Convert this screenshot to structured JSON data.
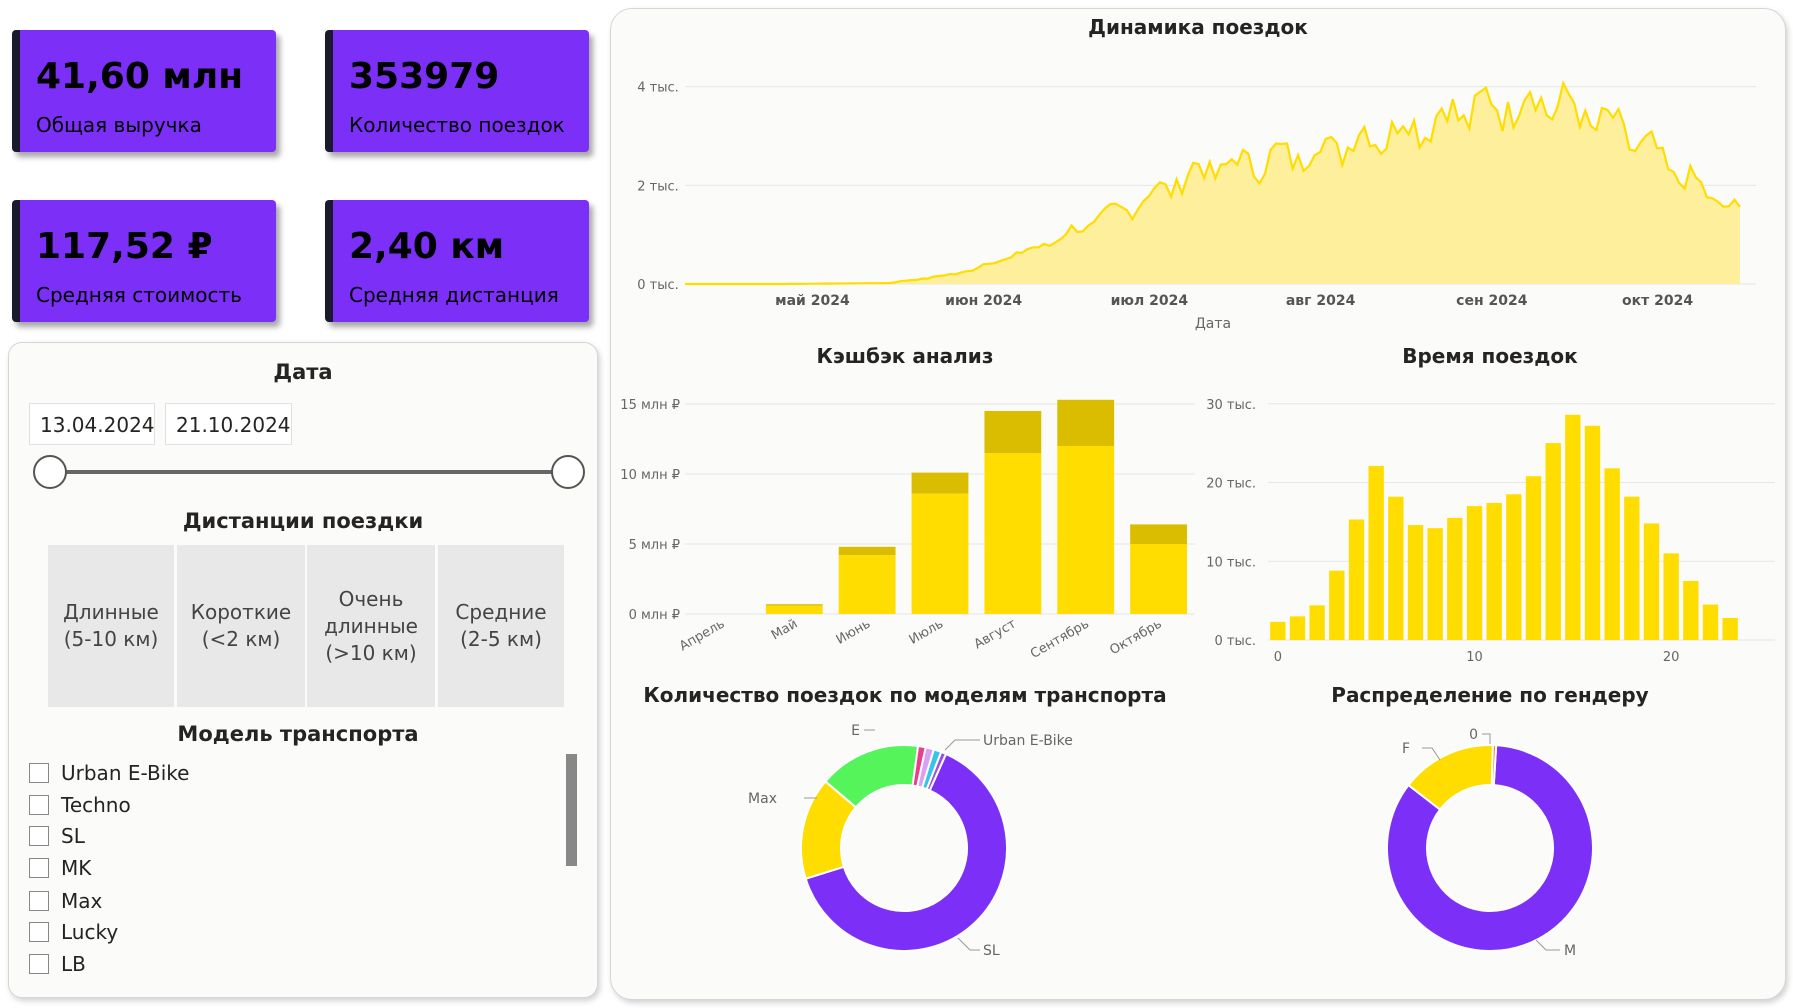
{
  "kpis": [
    {
      "value": "41,60 млн",
      "label": "Общая выручка"
    },
    {
      "value": "353979",
      "label": "Количество поездок"
    },
    {
      "value": "117,52 ₽",
      "label": "Средняя стоимость"
    },
    {
      "value": "2,40 км",
      "label": "Средняя дистанция"
    }
  ],
  "colors": {
    "accent": "#7b2ff7",
    "yellow": "#ffdd00",
    "yellow_dark": "#dbbd00",
    "line_fill": "#fdef9b",
    "green": "#55f45b",
    "pink": "#e83e8c",
    "cyan": "#36c5e8"
  },
  "slicers": {
    "date": {
      "title": "Дата",
      "start": "13.04.2024",
      "end": "21.10.2024"
    },
    "distance": {
      "title": "Дистанции поездки",
      "tiles": [
        "Длинные\n(5-10 км)",
        "Короткие\n(<2 км)",
        "Очень\nдлинные\n(>10 км)",
        "Средние\n(2-5 км)"
      ]
    },
    "models": {
      "title": "Модель транспорта",
      "items": [
        "Urban E-Bike",
        "Techno",
        "SL",
        "MK",
        "Max",
        "Lucky",
        "LB"
      ]
    }
  },
  "charts": {
    "trips_dynamic": {
      "title": "Динамика поездок",
      "xlabel": "Дата",
      "yticks": [
        "0 тыс.",
        "2 тыс.",
        "4 тыс."
      ],
      "xticks": [
        "май 2024",
        "июн 2024",
        "июл 2024",
        "авг 2024",
        "сен 2024",
        "окт 2024"
      ]
    },
    "cashback": {
      "title": "Кэшбэк анализ",
      "yticks": [
        "0 млн ₽",
        "5 млн ₽",
        "10 млн ₽",
        "15 млн ₽"
      ]
    },
    "trip_time": {
      "title": "Время поездок",
      "yticks": [
        "0 тыс.",
        "10 тыс.",
        "20 тыс.",
        "30 тыс."
      ],
      "xticks": [
        "0",
        "10",
        "20"
      ]
    },
    "models_donut": {
      "title": "Количество поездок по моделям транспорта",
      "labels": [
        "E",
        "Urban E-Bike",
        "Max",
        "SL"
      ]
    },
    "gender_donut": {
      "title": "Распределение по гендеру",
      "labels": [
        "0",
        "F",
        "M"
      ]
    }
  },
  "chart_data": [
    {
      "type": "area",
      "title": "Динамика поездок",
      "xlabel": "Дата",
      "ylabel": "",
      "x_range": [
        "2024-04-13",
        "2024-10-21"
      ],
      "ylim": [
        0,
        4500
      ],
      "grid": true,
      "monthly_points": [
        {
          "x": "2024-04-13",
          "y": 0
        },
        {
          "x": "2024-05-01",
          "y": 0
        },
        {
          "x": "2024-05-20",
          "y": 20
        },
        {
          "x": "2024-06-01",
          "y": 200
        },
        {
          "x": "2024-06-15",
          "y": 700
        },
        {
          "x": "2024-07-01",
          "y": 1500
        },
        {
          "x": "2024-07-15",
          "y": 2300
        },
        {
          "x": "2024-08-01",
          "y": 2600
        },
        {
          "x": "2024-08-15",
          "y": 3000
        },
        {
          "x": "2024-09-01",
          "y": 3500
        },
        {
          "x": "2024-09-15",
          "y": 3800
        },
        {
          "x": "2024-10-01",
          "y": 3000
        },
        {
          "x": "2024-10-10",
          "y": 2200
        },
        {
          "x": "2024-10-21",
          "y": 1400
        }
      ]
    },
    {
      "type": "bar",
      "title": "Кэшбэк анализ",
      "categories": [
        "Апрель",
        "Май",
        "Июнь",
        "Июль",
        "Август",
        "Сентябрь",
        "Октябрь"
      ],
      "series": [
        {
          "values": [
            0,
            0.6,
            4.2,
            8.6,
            11.5,
            12.0,
            5.0
          ]
        },
        {
          "values": [
            0,
            0.1,
            0.6,
            1.5,
            3.0,
            3.3,
            1.4
          ]
        }
      ],
      "stacked": true,
      "ylim": [
        0,
        16
      ],
      "grid": true
    },
    {
      "type": "bar",
      "title": "Время поездок",
      "categories": [
        0,
        1,
        2,
        3,
        4,
        5,
        6,
        7,
        8,
        9,
        10,
        11,
        12,
        13,
        14,
        15,
        16,
        17,
        18,
        19,
        20,
        21,
        22,
        23
      ],
      "values": [
        2.3,
        3.0,
        4.4,
        8.8,
        15.3,
        22.1,
        18.2,
        14.6,
        14.2,
        15.5,
        17.0,
        17.4,
        18.5,
        20.8,
        25.0,
        28.6,
        27.2,
        21.8,
        18.2,
        14.8,
        11.0,
        7.5,
        4.5,
        2.8
      ],
      "ylim": [
        0,
        32
      ],
      "grid": true
    },
    {
      "type": "pie",
      "title": "Количество поездок по моделям транспорта",
      "labels": [
        "SL",
        "Max",
        "E",
        "",
        "Urban E-Bike",
        "",
        ""
      ],
      "values": [
        63.5,
        16,
        16,
        1.2,
        1.3,
        1.2,
        0.8
      ],
      "colors": [
        "#7b2ff7",
        "#ffdd00",
        "#55f45b",
        "#e83e8c",
        "#d9a0f5",
        "#36c5e8",
        "#a050e0"
      ]
    },
    {
      "type": "pie",
      "title": "Распределение по гендеру",
      "labels": [
        "M",
        "F",
        "0"
      ],
      "values": [
        84.5,
        15,
        0.5
      ],
      "colors": [
        "#7b2ff7",
        "#ffdd00",
        "#f08030"
      ]
    }
  ]
}
